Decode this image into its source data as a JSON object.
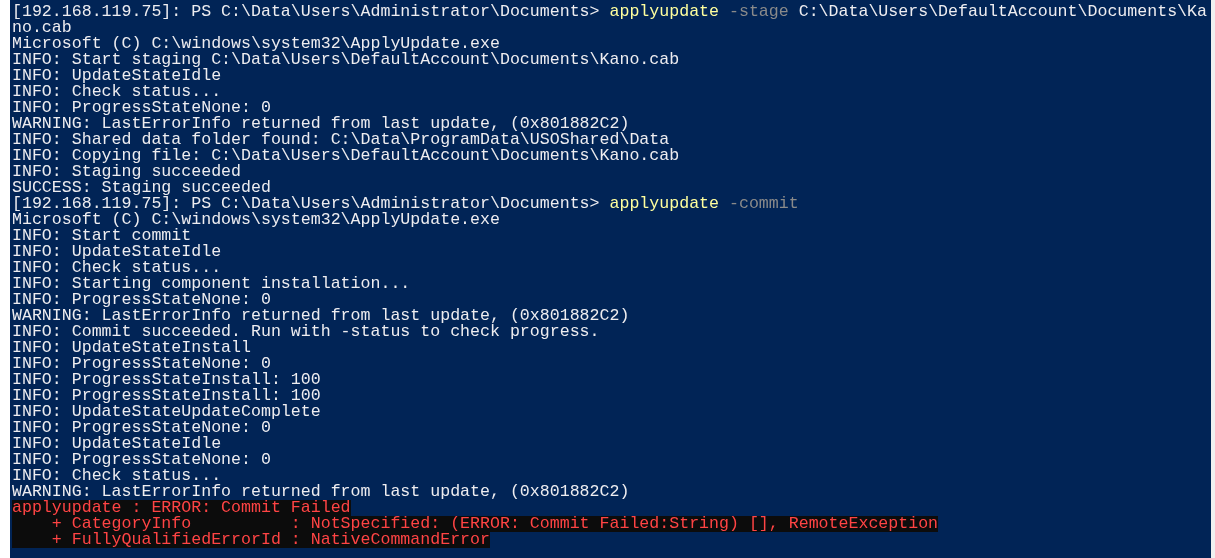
{
  "console": {
    "lines": [
      [
        {
          "kind": "prompt",
          "text": "[192.168.119.75]: PS C:\\Data\\Users\\Administrator\\Documents> "
        },
        {
          "kind": "command",
          "text": "applyupdate"
        },
        {
          "kind": "parameter",
          "text": " -stage"
        },
        {
          "kind": "output",
          "text": " C:\\Data\\Users\\DefaultAccount\\Documents\\Ka"
        }
      ],
      [
        {
          "kind": "output",
          "text": "no.cab"
        }
      ],
      [
        {
          "kind": "output",
          "text": "Microsoft (C) C:\\windows\\system32\\ApplyUpdate.exe"
        }
      ],
      [
        {
          "kind": "output",
          "text": "INFO: Start staging C:\\Data\\Users\\DefaultAccount\\Documents\\Kano.cab"
        }
      ],
      [
        {
          "kind": "output",
          "text": "INFO: UpdateStateIdle"
        }
      ],
      [
        {
          "kind": "output",
          "text": "INFO: Check status..."
        }
      ],
      [
        {
          "kind": "output",
          "text": "INFO: ProgressStateNone: 0"
        }
      ],
      [
        {
          "kind": "output",
          "text": "WARNING: LastErrorInfo returned from last update, (0x801882C2)"
        }
      ],
      [
        {
          "kind": "output",
          "text": "INFO: Shared data folder found: C:\\Data\\ProgramData\\USOShared\\Data"
        }
      ],
      [
        {
          "kind": "output",
          "text": "INFO: Copying file: C:\\Data\\Users\\DefaultAccount\\Documents\\Kano.cab"
        }
      ],
      [
        {
          "kind": "output",
          "text": "INFO: Staging succeeded"
        }
      ],
      [
        {
          "kind": "output",
          "text": "SUCCESS: Staging succeeded"
        }
      ],
      [
        {
          "kind": "prompt",
          "text": "[192.168.119.75]: PS C:\\Data\\Users\\Administrator\\Documents> "
        },
        {
          "kind": "command",
          "text": "applyupdate"
        },
        {
          "kind": "parameter",
          "text": " -commit"
        }
      ],
      [
        {
          "kind": "output",
          "text": "Microsoft (C) C:\\windows\\system32\\ApplyUpdate.exe"
        }
      ],
      [
        {
          "kind": "output",
          "text": "INFO: Start commit"
        }
      ],
      [
        {
          "kind": "output",
          "text": "INFO: UpdateStateIdle"
        }
      ],
      [
        {
          "kind": "output",
          "text": "INFO: Check status..."
        }
      ],
      [
        {
          "kind": "output",
          "text": "INFO: Starting component installation..."
        }
      ],
      [
        {
          "kind": "output",
          "text": "INFO: ProgressStateNone: 0"
        }
      ],
      [
        {
          "kind": "output",
          "text": "WARNING: LastErrorInfo returned from last update, (0x801882C2)"
        }
      ],
      [
        {
          "kind": "output",
          "text": "INFO: Commit succeeded. Run with -status to check progress."
        }
      ],
      [
        {
          "kind": "output",
          "text": "INFO: UpdateStateInstall"
        }
      ],
      [
        {
          "kind": "output",
          "text": "INFO: ProgressStateNone: 0"
        }
      ],
      [
        {
          "kind": "output",
          "text": "INFO: ProgressStateInstall: 100"
        }
      ],
      [
        {
          "kind": "output",
          "text": "INFO: ProgressStateInstall: 100"
        }
      ],
      [
        {
          "kind": "output",
          "text": "INFO: UpdateStateUpdateComplete"
        }
      ],
      [
        {
          "kind": "output",
          "text": "INFO: ProgressStateNone: 0"
        }
      ],
      [
        {
          "kind": "output",
          "text": "INFO: UpdateStateIdle"
        }
      ],
      [
        {
          "kind": "output",
          "text": "INFO: ProgressStateNone: 0"
        }
      ],
      [
        {
          "kind": "output",
          "text": "INFO: Check status..."
        }
      ],
      [
        {
          "kind": "output",
          "text": "WARNING: LastErrorInfo returned from last update, (0x801882C2)"
        }
      ],
      [
        {
          "kind": "error",
          "text": "applyupdate : ERROR: Commit Failed"
        }
      ],
      [
        {
          "kind": "error",
          "text": "    + CategoryInfo          : NotSpecified: (ERROR: Commit Failed:String) [], RemoteException"
        }
      ],
      [
        {
          "kind": "error",
          "text": "    + FullyQualifiedErrorId : NativeCommandError"
        }
      ]
    ]
  }
}
